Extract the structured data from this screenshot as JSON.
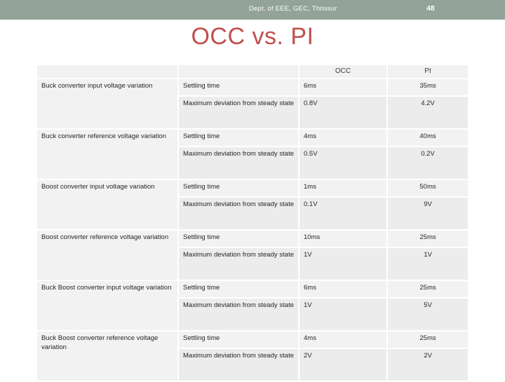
{
  "header": {
    "department": "Dept. of EEE, GEC, Thrissur",
    "slide_number": "48",
    "band_color": "#93a399"
  },
  "title": {
    "text": "OCC vs. PI",
    "color": "#c0504d"
  },
  "table": {
    "columns": [
      "",
      "",
      "OCC",
      "PI"
    ],
    "metric_labels": {
      "settling": "Settling time",
      "deviation": "Maximum deviation from steady state"
    },
    "rows": [
      {
        "parameter": "Buck converter input voltage variation",
        "settling": {
          "metric": "Settling time",
          "occ": "6ms",
          "pi": "35ms"
        },
        "deviation": {
          "metric": "Maximum deviation from steady state",
          "occ": "0.8V",
          "pi": "4.2V"
        }
      },
      {
        "parameter": "Buck converter reference voltage variation",
        "settling": {
          "metric": "Settling time",
          "occ": "4ms",
          "pi": "40ms"
        },
        "deviation": {
          "metric": "Maximum deviation from steady state",
          "occ": "0.5V",
          "pi": "0.2V"
        }
      },
      {
        "parameter": "Boost converter input voltage variation",
        "settling": {
          "metric": "Settling time",
          "occ": "1ms",
          "pi": "50ms"
        },
        "deviation": {
          "metric": "Maximum deviation from steady state",
          "occ": "0.1V",
          "pi": "9V"
        }
      },
      {
        "parameter": "Boost  converter reference voltage variation",
        "settling": {
          "metric": "Settling time",
          "occ": "10ms",
          "pi": "25ms"
        },
        "deviation": {
          "metric": "Maximum deviation from steady state",
          "occ": "1V",
          "pi": "1V"
        }
      },
      {
        "parameter": "Buck Boost converter input voltage variation",
        "settling": {
          "metric": "Settling time",
          "occ": "6ms",
          "pi": "25ms"
        },
        "deviation": {
          "metric": "Maximum deviation from steady state",
          "occ": "1V",
          "pi": "5V"
        }
      },
      {
        "parameter": "Buck Boost converter reference voltage variation",
        "settling": {
          "metric": "Settling time",
          "occ": "4ms",
          "pi": "25ms"
        },
        "deviation": {
          "metric": "Maximum deviation from steady state",
          "occ": "2V",
          "pi": "2V"
        }
      }
    ]
  }
}
